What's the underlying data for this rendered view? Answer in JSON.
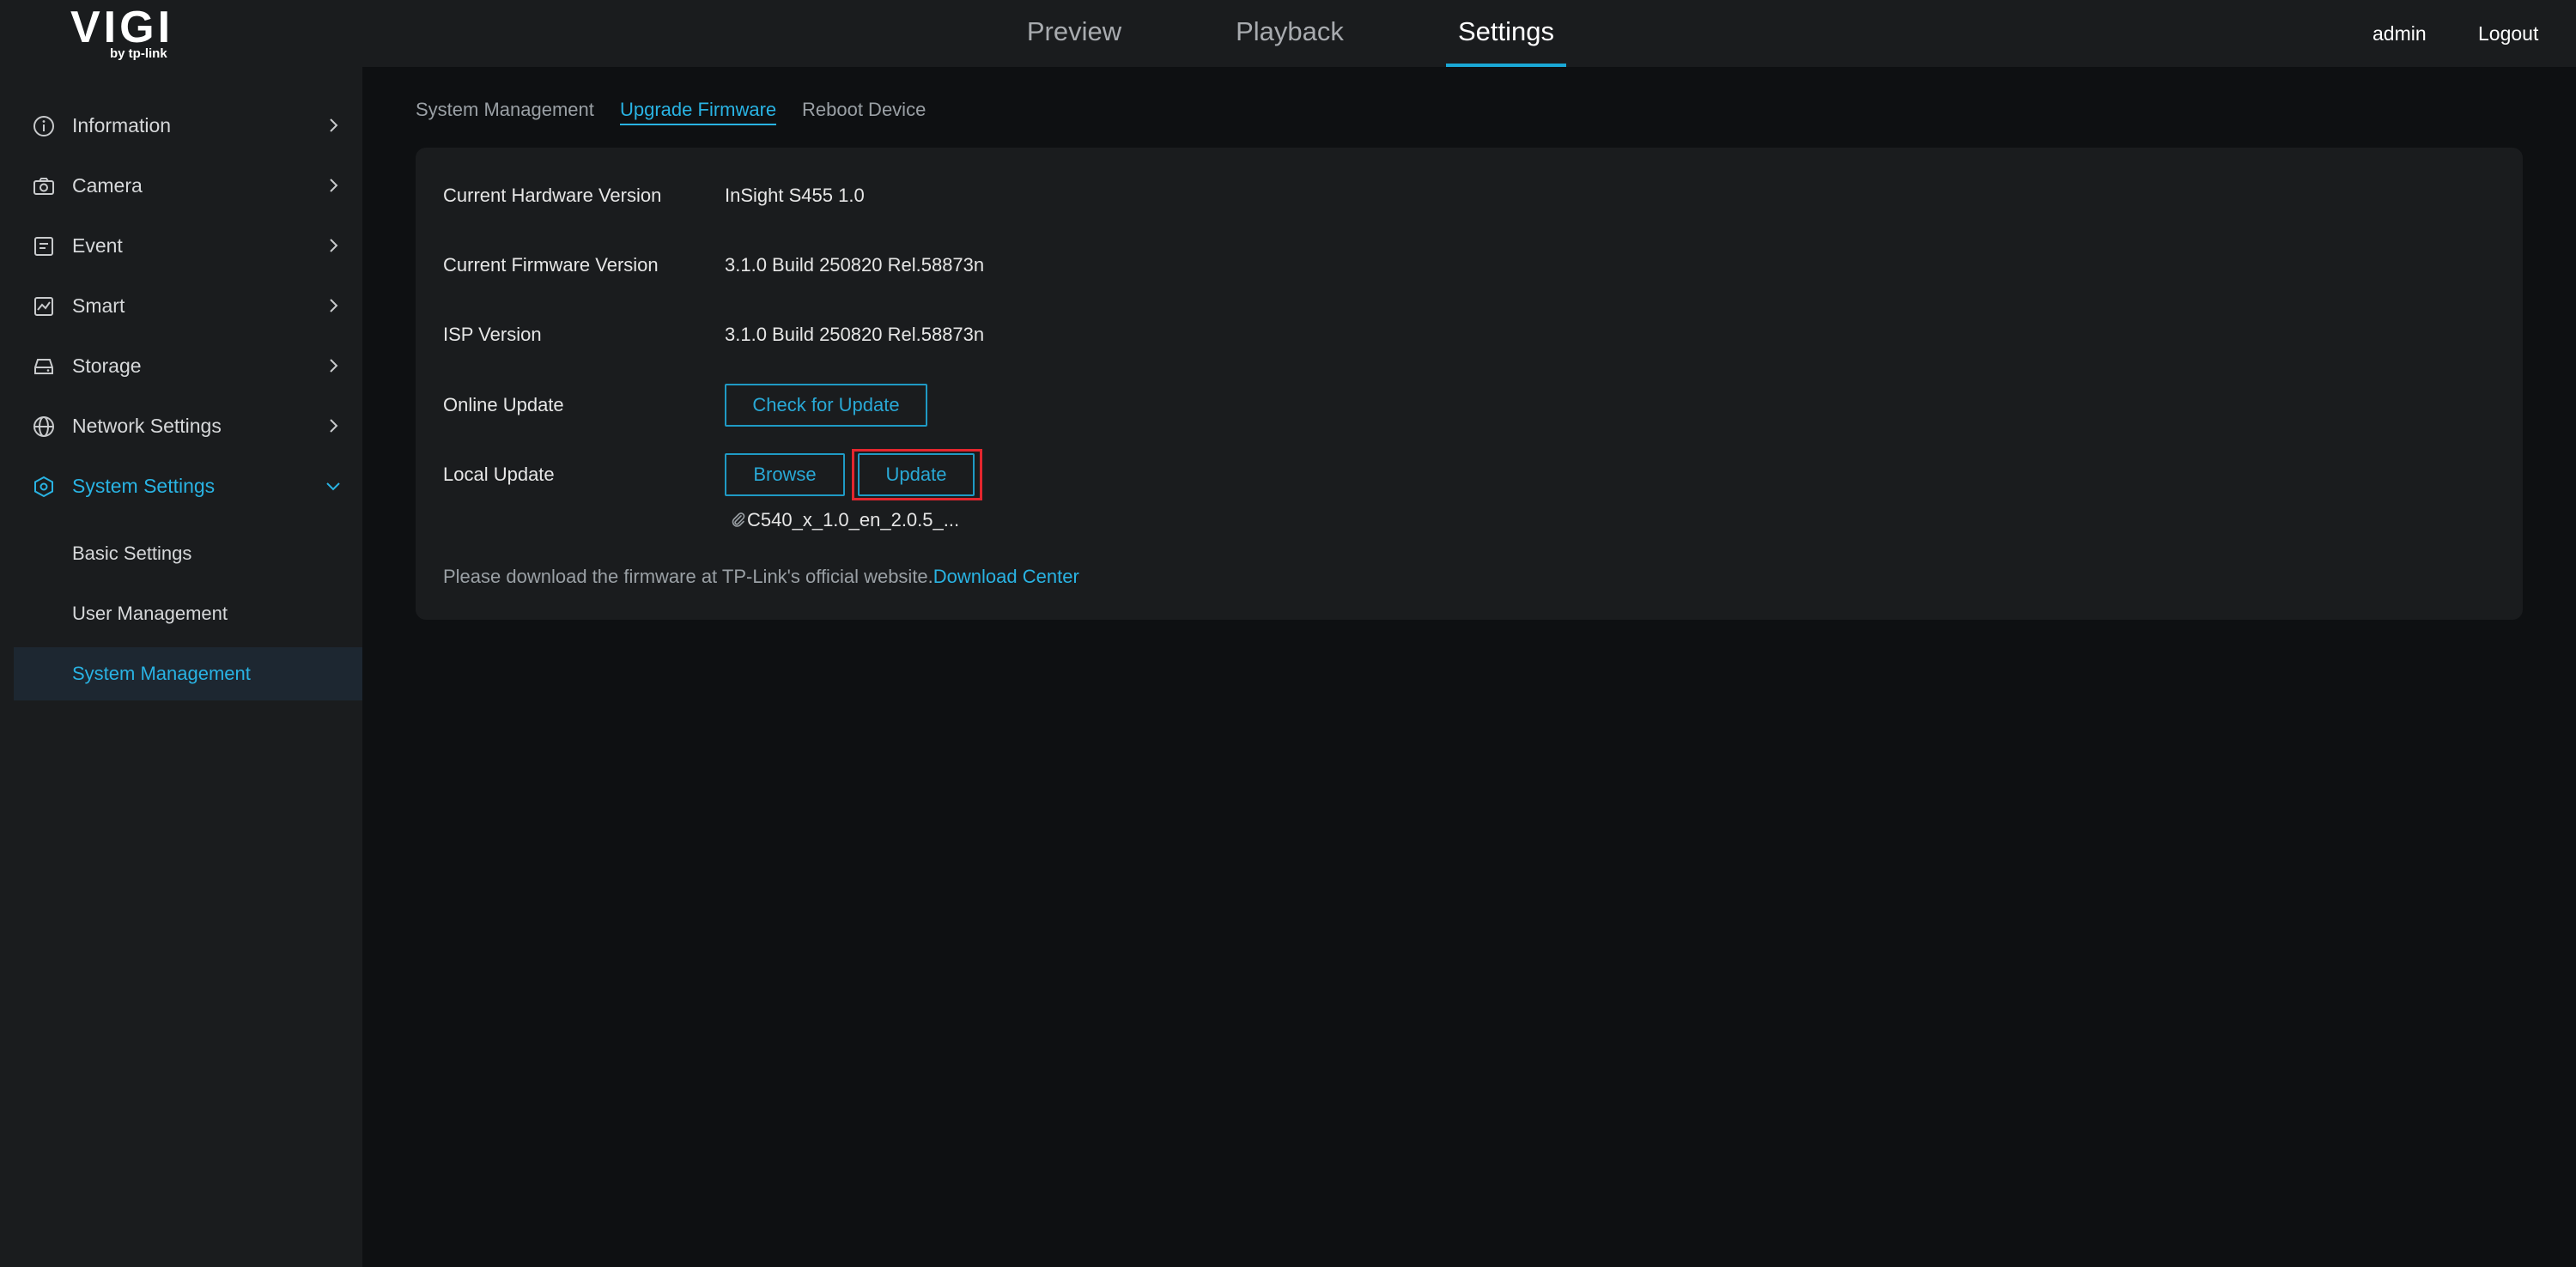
{
  "logo": {
    "main": "VIGI",
    "sub": "by tp-link"
  },
  "top_nav": {
    "tabs": [
      {
        "label": "Preview",
        "active": false
      },
      {
        "label": "Playback",
        "active": false
      },
      {
        "label": "Settings",
        "active": true
      }
    ],
    "user": "admin",
    "logout": "Logout"
  },
  "sidebar": {
    "items": [
      {
        "label": "Information",
        "icon": "info-icon"
      },
      {
        "label": "Camera",
        "icon": "camera-icon"
      },
      {
        "label": "Event",
        "icon": "event-icon"
      },
      {
        "label": "Smart",
        "icon": "smart-icon"
      },
      {
        "label": "Storage",
        "icon": "storage-icon"
      },
      {
        "label": "Network Settings",
        "icon": "globe-icon"
      },
      {
        "label": "System Settings",
        "icon": "hexagon-gear-icon",
        "expanded": true
      }
    ],
    "sub_items": [
      {
        "label": "Basic Settings"
      },
      {
        "label": "User Management"
      },
      {
        "label": "System Management",
        "selected": true
      }
    ]
  },
  "subtabs": [
    {
      "label": "System Management"
    },
    {
      "label": "Upgrade Firmware",
      "active": true
    },
    {
      "label": "Reboot Device"
    }
  ],
  "firmware": {
    "hardware_label": "Current Hardware Version",
    "hardware_value": "InSight S455 1.0",
    "firmware_label": "Current Firmware Version",
    "firmware_value": "3.1.0 Build 250820 Rel.58873n",
    "isp_label": "ISP Version",
    "isp_value": "3.1.0 Build 250820 Rel.58873n",
    "online_label": "Online Update",
    "check_button": "Check for Update",
    "local_label": "Local Update",
    "browse_button": "Browse",
    "update_button": "Update",
    "file_name": "C540_x_1.0_en_2.0.5_...",
    "notice_text": "Please download the firmware at TP-Link's official website.",
    "download_link": "Download Center"
  },
  "colors": {
    "accent": "#29b3e3",
    "highlight": "#e3262e",
    "background": "#0e1012",
    "panel": "#1a1c1e"
  }
}
